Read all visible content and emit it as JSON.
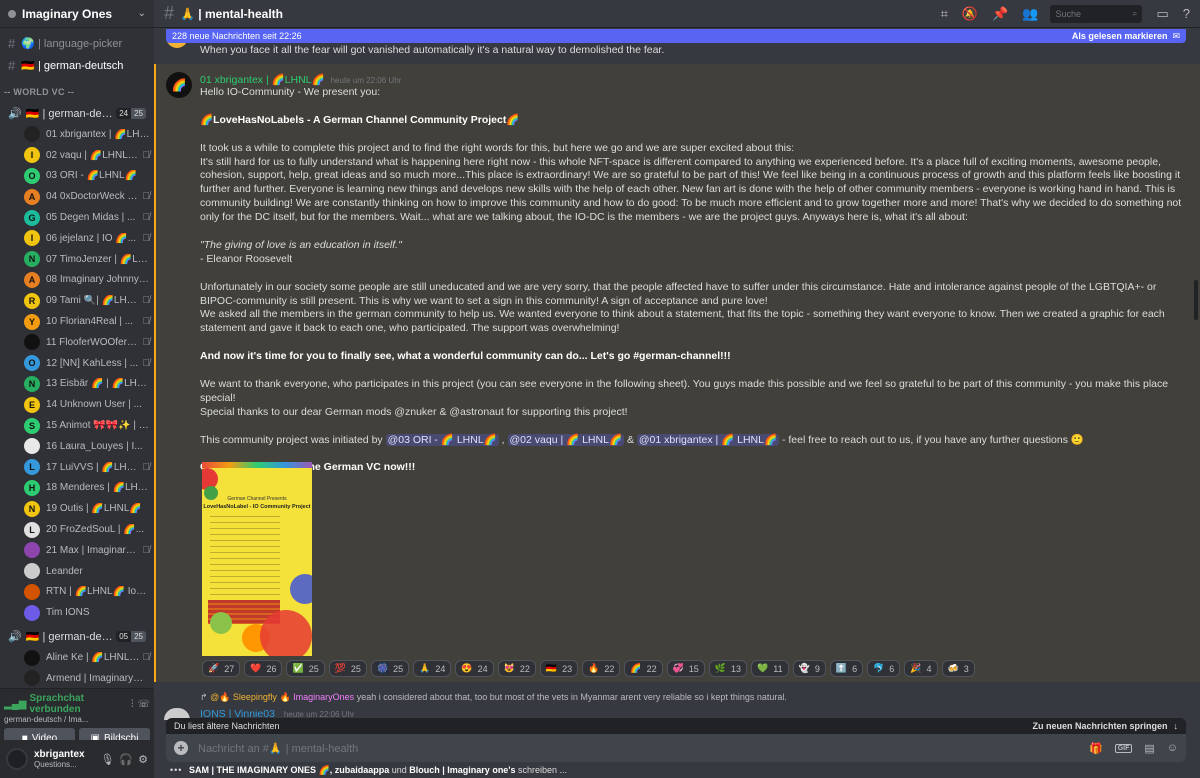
{
  "server": {
    "name": "Imaginary Ones"
  },
  "channels": [
    {
      "label": "🌍 | language-picker"
    },
    {
      "label": "🇩🇪 | german-deutsch"
    }
  ],
  "category": {
    "label": "-- WORLD VC --"
  },
  "voice_channel_1": {
    "label": "🇩🇪 | german-deu...",
    "count": "24",
    "limit": "25"
  },
  "voice_users_1": [
    {
      "name": "01 xbrigantex | 🌈LHNL🌈",
      "letter": "",
      "color": "#222222",
      "mic": ""
    },
    {
      "name": "02 vaqu | 🌈LHNL🌈",
      "letter": "I",
      "color": "#f1c40f",
      "mic": "🎙̸"
    },
    {
      "name": "03 ORI - 🌈LHNL🌈",
      "letter": "O",
      "color": "#2ecc71",
      "mic": ""
    },
    {
      "name": "04 0xDoctorWeck | ...",
      "letter": "A",
      "color": "#e67e22",
      "mic": "🎙̸"
    },
    {
      "name": "05 Degen Midas | ...",
      "letter": "G",
      "color": "#1abc9c",
      "mic": "🎙̸"
    },
    {
      "name": "06 jejelanz | IO 🌈...",
      "letter": "I",
      "color": "#f1c40f",
      "mic": "🎙̸"
    },
    {
      "name": "07 TimoJenzer | 🌈LHNL...",
      "letter": "N",
      "color": "#27ae60",
      "mic": ""
    },
    {
      "name": "08 Imaginary Johnny 🌈...",
      "letter": "A",
      "color": "#e67e22",
      "mic": ""
    },
    {
      "name": "09 Tami 🔍| 🌈LHN...",
      "letter": "R",
      "color": "#f1c40f",
      "mic": "🎙̸"
    },
    {
      "name": "10 Florian4Real | ...",
      "letter": "Y",
      "color": "#f39c12",
      "mic": "🎙̸"
    },
    {
      "name": "11 FlooferWOOfer | ...",
      "letter": "",
      "color": "#111111",
      "mic": "🎙̸"
    },
    {
      "name": "12 [NN] KahLess | ...",
      "letter": "O",
      "color": "#3498db",
      "mic": "🎙̸"
    },
    {
      "name": "13 Eisbär 🌈 | 🌈LHNL🌈",
      "letter": "N",
      "color": "#27ae60",
      "mic": ""
    },
    {
      "name": "14 Unknown User | ...",
      "letter": "E",
      "color": "#f1c40f",
      "mic": ""
    },
    {
      "name": "15 Animot 🎀🎀✨ | 🌈LH...",
      "letter": "S",
      "color": "#2ecc71",
      "mic": ""
    },
    {
      "name": "16 Laura_Louyes | I...",
      "letter": "",
      "color": "#e8e8e8",
      "mic": ""
    },
    {
      "name": "17 LuiVVS | 🌈LHNL...",
      "letter": "L",
      "color": "#3498db",
      "mic": "🎙̸"
    },
    {
      "name": "18 Menderes | 🌈LHNL🌈",
      "letter": "H",
      "color": "#2ecc71",
      "mic": ""
    },
    {
      "name": "19 Outis | 🌈LHNL🌈",
      "letter": "N",
      "color": "#f1c40f",
      "mic": ""
    },
    {
      "name": "20 FroZedSouL | 🌈...",
      "letter": "L",
      "color": "#e0e0e0",
      "mic": ""
    },
    {
      "name": "21 Max | Imaginary ...",
      "letter": "",
      "color": "#8e44ad",
      "mic": "🎙̸"
    },
    {
      "name": "Leander",
      "letter": "",
      "color": "#cccccc",
      "mic": ""
    },
    {
      "name": "RTN | 🌈LHNL🌈 Ions 4 ...",
      "letter": "",
      "color": "#d35400",
      "mic": ""
    },
    {
      "name": "Tim IONS",
      "letter": "",
      "color": "#6c5ce7",
      "mic": ""
    }
  ],
  "voice_channel_2": {
    "label": "🇩🇪 | german-deu...",
    "count": "05",
    "limit": "25"
  },
  "voice_users_2": [
    {
      "name": "Aline Ke | 🌈LHNL🌈",
      "letter": "",
      "color": "#111111",
      "mic": "🎙̸"
    },
    {
      "name": "Armend | ImaginaryOne ...",
      "letter": "",
      "color": "#222222",
      "mic": ""
    }
  ],
  "voice_panel": {
    "status": "Sprachchat verbunden",
    "sub": "german-deutsch / Ima...",
    "video": "Video",
    "screen": "Bildschi"
  },
  "user_panel": {
    "name": "xbrigantex",
    "status": "Questions..."
  },
  "topbar": {
    "channel": "🙏 | mental-health",
    "search_placeholder": "Suche"
  },
  "newbar": {
    "left": "228 neue Nachrichten seit 22:26",
    "right": "Als gelesen markieren"
  },
  "prev_message": "When you face it all the fear will got vanished automatically it's a natural way to demolished the fear.",
  "message": {
    "author": "01 xbrigantex | 🌈LHNL🌈",
    "time": "heute um 22:06 Uhr",
    "l1": "Hello IO-Community - We present you:",
    "l2": "🌈LoveHasNoLabels - A German Channel Community Project🌈",
    "p1": "It took us a while to complete this project and to find the right words for this, but here we go and we are super excited about this:",
    "p2": "It's still hard for us to fully understand what is happening here right now - this whole NFT-space is different compared to anything we experienced before. It's a place full of exciting moments, awesome people, cohesion, support, help, great ideas and so much more...This place is extraordinary! We are so grateful to be part of this! We feel like being in a continuous process of growth and this platform feels like boosting it further and further. Everyone is learning new things and develops new skills with the help of each other. New fan art is done with the help of other community members - everyone is working hand in hand. This is community building! We are constantly thinking on how to improve this community and how to do good: To be much more efficient and to grow together more and more! That's why we decided to do something not only for the DC itself, but for the members. Wait... what are we talking about, the IO-DC is the members - we are the project guys. Anyways here is, what it's all about:",
    "quote": "\"The giving of love is an education in itself.\"",
    "quote_author": "- Eleanor Roosevelt",
    "p3": "Unfortunately in our society some people are still uneducated and we are very sorry, that the people affected have to suffer under this circumstance. Hate and intolerance against people of the LGBTQIA+- or BIPOC-community is still present. This is why we want to set a sign in this community! A sign of acceptance and pure love!",
    "p4": "We asked all the members in the german community to help us. We wanted everyone to think about a statement, that fits the topic - something they want everyone to know. Then we created a graphic for each statement and gave it back to each one, who participated. The support was overwhelming!",
    "p5": "And now it's time for you to finally see, what a wonderful community can do... Let's go #german-channel!!!",
    "p6": "We want to thank everyone, who participates in this project (you can see everyone in the following sheet). You guys made this possible and we feel so grateful to be part of this community - you make this place special!",
    "p7": "Special thanks to our dear German mods @znuker & @astronaut for supporting this project!",
    "p8_pre": "This community project was initiated by",
    "mention1": "@03 ORI - 🌈 LHNL🌈",
    "mention2": "@02 vaqu | 🌈 LHNL🌈",
    "amp": "&",
    "mention3": "@01 xbrigantex | 🌈 LHNL🌈",
    "p8_post": "- feel free to reach out to us, if you have any further questions",
    "p9": "On last thing: Check the German VC now!!!",
    "poster_line1": "German Channel Presents",
    "poster_line2": "LoveHasNoLabel - IO Community Project"
  },
  "reactions": [
    {
      "emoji": "🚀",
      "count": "27"
    },
    {
      "emoji": "❤️",
      "count": "26"
    },
    {
      "emoji": "✅",
      "count": "25"
    },
    {
      "emoji": "💯",
      "count": "25"
    },
    {
      "emoji": "🎆",
      "count": "25"
    },
    {
      "emoji": "🙏",
      "count": "24"
    },
    {
      "emoji": "😍",
      "count": "24"
    },
    {
      "emoji": "😻",
      "count": "22"
    },
    {
      "emoji": "🇩🇪",
      "count": "23"
    },
    {
      "emoji": "🔥",
      "count": "22"
    },
    {
      "emoji": "🌈",
      "count": "22"
    },
    {
      "emoji": "💞",
      "count": "15"
    },
    {
      "emoji": "🌿",
      "count": "13"
    },
    {
      "emoji": "💚",
      "count": "11"
    },
    {
      "emoji": "👻",
      "count": "9"
    },
    {
      "emoji": "⬆️",
      "count": "6"
    },
    {
      "emoji": "🐬",
      "count": "6"
    },
    {
      "emoji": "🎉",
      "count": "4"
    },
    {
      "emoji": "🍻",
      "count": "3"
    }
  ],
  "reply": {
    "name1": "@🔥 Sleepingfly",
    "name2": "🔥 ImaginaryOnes",
    "text": "yeah i considered about that, too but most of the vets in Myanmar arent very reliable so i kept things natural."
  },
  "next_message": {
    "author": "IONS | Vinnie03",
    "time": "heute um 22:06 Uhr"
  },
  "older_bar": {
    "left": "Du liest ältere Nachrichten",
    "right": "Zu neuen Nachrichten springen"
  },
  "composer": {
    "placeholder": "Nachricht an #🙏 | mental-health",
    "gif": "GIF"
  },
  "typing": {
    "names": "SAM | THE IMAGINARY ONES 🌈, zubaidaappa",
    "mid": "und",
    "name3": "Blouch | Imaginary one's",
    "tail": "schreiben ..."
  }
}
